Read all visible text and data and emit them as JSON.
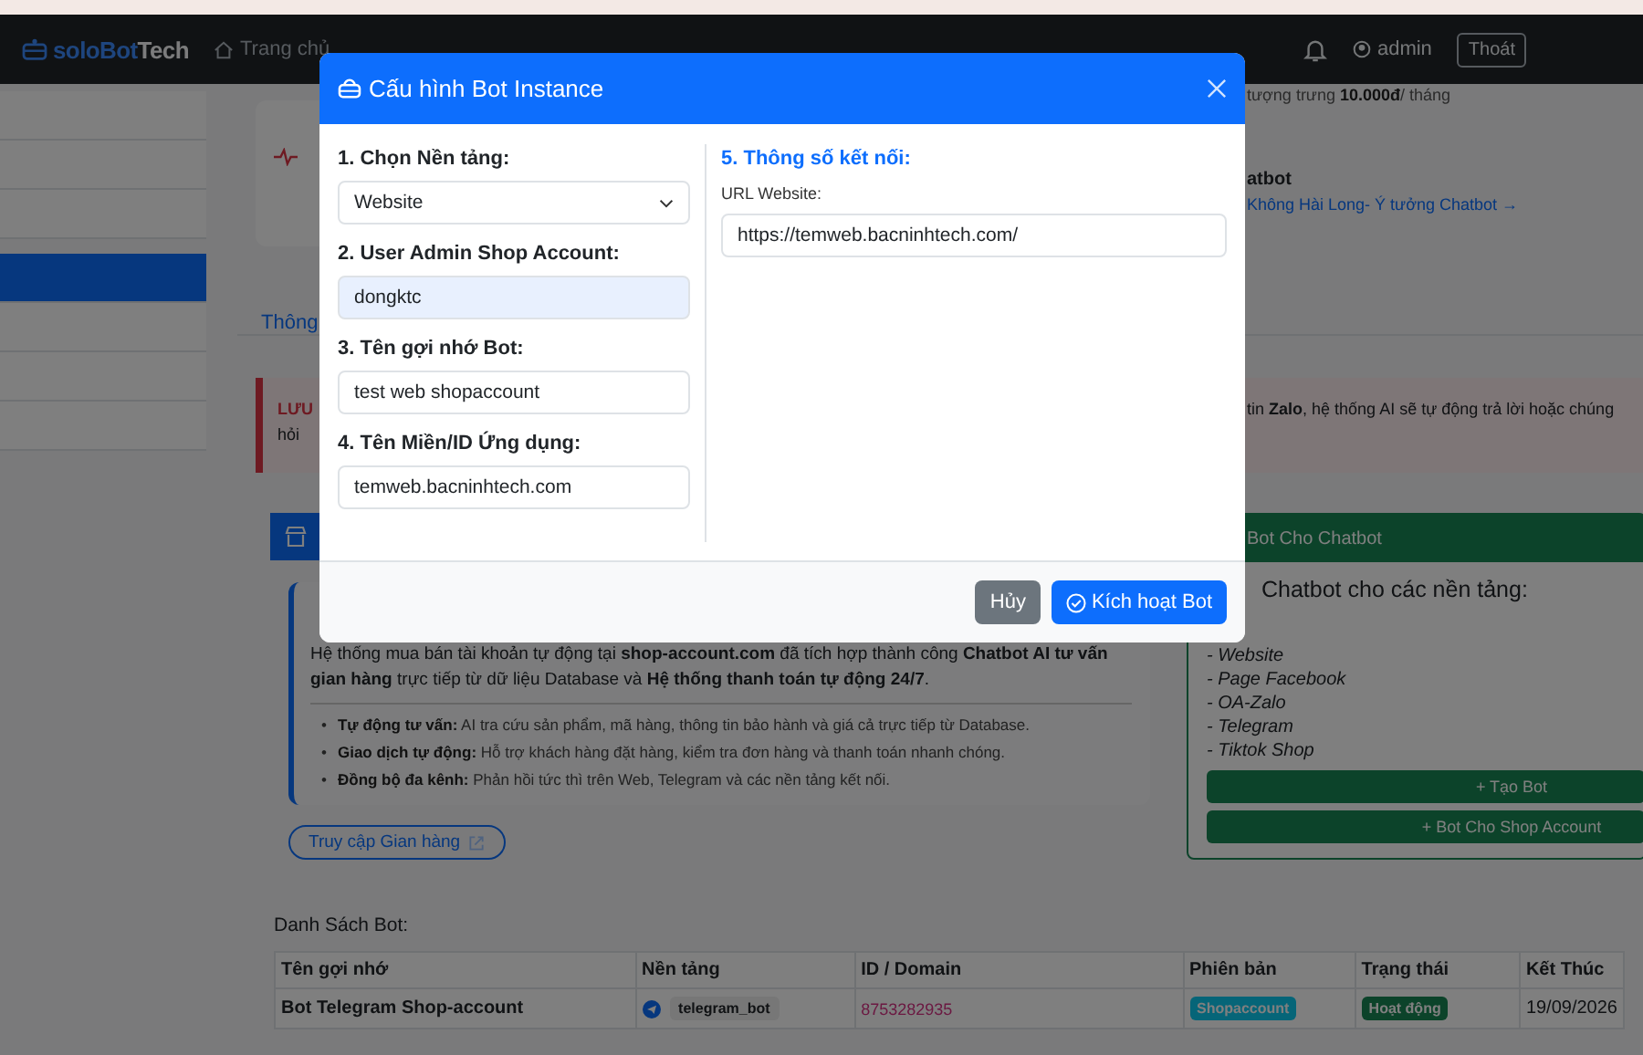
{
  "navbar": {
    "logo": {
      "brand": "soloBot",
      "accent": "Tech"
    },
    "links": [
      {
        "label": "Trang chủ"
      }
    ],
    "user": "admin",
    "logout": "Thoát"
  },
  "sidebar": {
    "items": [
      {
        "selected": false
      },
      {
        "selected": false
      },
      {
        "selected": false
      },
      {
        "selected": true
      },
      {
        "selected": false
      },
      {
        "selected": false
      },
      {
        "selected": false
      }
    ]
  },
  "pricing_note": "tượng trưng **10.000đ**/ tháng",
  "chatbot_promo": {
    "title": "atbot",
    "link": "Không Hài Long- Ý tưởng Chatbot →"
  },
  "tabs": [
    {
      "label": "Thông",
      "selected": true
    }
  ],
  "alert": {
    "title": "LƯU",
    "left_text": "hỏi",
    "right_text": "tin **Zalo**, hệ thống AI sẽ tự động trả lời hoặc chúng"
  },
  "store_card": {
    "description": "Hệ thống mua bán tài khoản tự động tại **shop-account.com** đã tích hợp thành công **Chatbot AI tư vấn gian hàng** trực tiếp từ dữ liệu Database và **Hệ thống thanh toán tự động 24/7**.",
    "bullet": "•",
    "features": [
      {
        "title": "Tự động tư vấn:",
        "text": "AI tra cứu sản phẩm, mã hàng, thông tin bảo hành và giá cả trực tiếp từ Database."
      },
      {
        "title": "Giao dịch tự động:",
        "text": "Hỗ trợ khách hàng đặt hàng, kiểm tra đơn hàng và thanh toán nhanh chóng."
      },
      {
        "title": "Đồng bộ đa kênh:",
        "text": "Phản hồi tức thì trên Web, Telegram và các nền tảng kết nối."
      }
    ],
    "link": "Truy cập Gian hàng"
  },
  "bot_card": {
    "header": "Bot Cho Chatbot",
    "heading": "Chatbot cho các nền tảng:",
    "platforms": [
      "- Website",
      "- Page Facebook",
      "- OA-Zalo",
      "- Telegram",
      "- Tiktok Shop"
    ],
    "buttons": [
      "+ Tạo Bot",
      "+ Bot Cho Shop Account"
    ]
  },
  "bot_list": {
    "title": "Danh Sách Bot:",
    "columns": [
      "Tên gợi nhớ",
      "Nền tảng",
      "ID / Domain",
      "Phiên bản",
      "Trạng thái",
      "Kết Thúc"
    ],
    "rows": [
      {
        "name": "Bot Telegram Shop-account",
        "platform": "telegram_bot",
        "id": "8753282935",
        "version": "Shopaccount",
        "status": "Hoạt động",
        "end": "19/09/2026"
      }
    ]
  },
  "modal": {
    "title": "Cấu hình Bot Instance",
    "fields": [
      {
        "label": "1. Chọn Nền tảng:",
        "kind": "select",
        "value": "Website"
      },
      {
        "label": "2. User Admin Shop Account:",
        "kind": "readonly",
        "value": "dongktc"
      },
      {
        "label": "3. Tên gợi nhớ Bot:",
        "kind": "text",
        "value": "test web shopaccount"
      },
      {
        "label": "4. Tên Miền/ID Ứng dụng:",
        "kind": "text",
        "value": "temweb.bacninhtech.com"
      }
    ],
    "connection": {
      "heading": "5. Thông số kết nối:",
      "label": "URL Website:",
      "value": "https://temweb.bacninhtech.com/"
    },
    "buttons": [
      {
        "label": "Hủy",
        "kind": "secondary"
      },
      {
        "label": "Kích hoạt Bot",
        "kind": "primary"
      }
    ]
  }
}
